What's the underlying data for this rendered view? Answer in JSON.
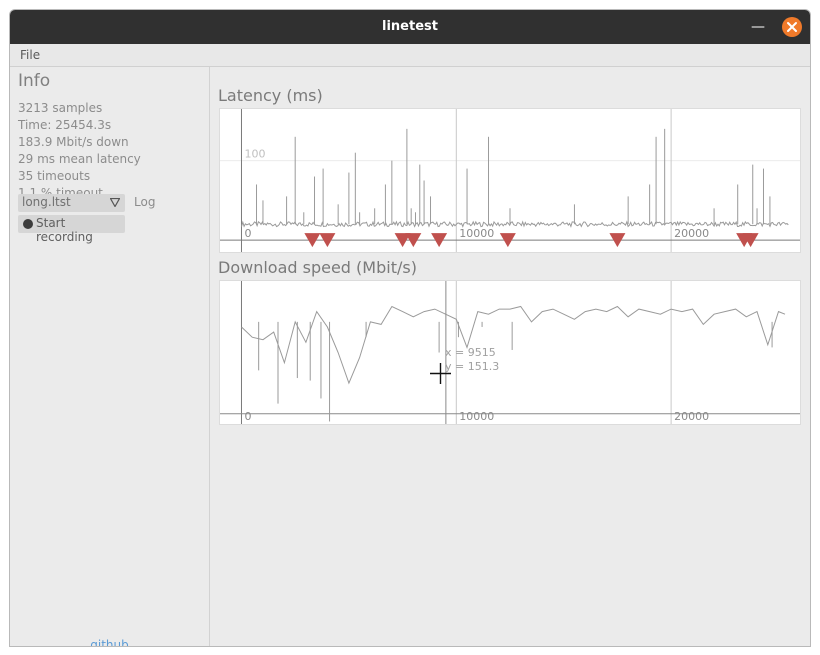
{
  "window": {
    "title": "linetest"
  },
  "menu": {
    "file_label": "File"
  },
  "sidebar": {
    "info_title": "Info",
    "stats": [
      "3213 samples",
      "Time: 25454.3s",
      "183.9 Mbit/s down",
      "29 ms mean latency",
      "35 timeouts",
      "1.1 % timeout"
    ],
    "file_select": {
      "value": "long.ltst"
    },
    "log_label": "Log",
    "record_button_label": "Start recording",
    "github_link": "github"
  },
  "latency_plot": {
    "title": "Latency (ms)",
    "x_ticks": [
      "0",
      "10000",
      "20000"
    ],
    "y_tick": "100"
  },
  "download_plot": {
    "title": "Download speed (Mbit/s)",
    "x_ticks": [
      "0",
      "10000",
      "20000"
    ],
    "cursor_readout": {
      "x": "x = 9515",
      "y": "y = 151.3"
    }
  },
  "colors": {
    "timeout_marker": "#c0504d",
    "trace": "#9a9a9a",
    "accent_close": "#f07a2a",
    "link": "#5b9bd5"
  },
  "chart_data": [
    {
      "type": "line",
      "title": "Latency (ms)",
      "x_ticks": [
        0,
        10000,
        20000
      ],
      "y_ticks": [
        100
      ],
      "xlim": [
        -1000,
        26000
      ],
      "ylim": [
        -15,
        165
      ],
      "baseline_ms": 20,
      "spikes": [
        {
          "x": 700,
          "y": 70
        },
        {
          "x": 1000,
          "y": 50
        },
        {
          "x": 2100,
          "y": 55
        },
        {
          "x": 2500,
          "y": 130
        },
        {
          "x": 2900,
          "y": 35
        },
        {
          "x": 3400,
          "y": 80
        },
        {
          "x": 3800,
          "y": 90
        },
        {
          "x": 4500,
          "y": 45
        },
        {
          "x": 5000,
          "y": 85
        },
        {
          "x": 5300,
          "y": 110
        },
        {
          "x": 5500,
          "y": 35
        },
        {
          "x": 6200,
          "y": 40
        },
        {
          "x": 6700,
          "y": 70
        },
        {
          "x": 7000,
          "y": 100
        },
        {
          "x": 7700,
          "y": 140
        },
        {
          "x": 7900,
          "y": 40
        },
        {
          "x": 8100,
          "y": 35
        },
        {
          "x": 8300,
          "y": 95
        },
        {
          "x": 8500,
          "y": 75
        },
        {
          "x": 8800,
          "y": 55
        },
        {
          "x": 10500,
          "y": 90
        },
        {
          "x": 11500,
          "y": 130
        },
        {
          "x": 12500,
          "y": 40
        },
        {
          "x": 15500,
          "y": 45
        },
        {
          "x": 18000,
          "y": 55
        },
        {
          "x": 19000,
          "y": 70
        },
        {
          "x": 19300,
          "y": 130
        },
        {
          "x": 19700,
          "y": 140
        },
        {
          "x": 22000,
          "y": 40
        },
        {
          "x": 23100,
          "y": 70
        },
        {
          "x": 23800,
          "y": 95
        },
        {
          "x": 24000,
          "y": 40
        },
        {
          "x": 24300,
          "y": 90
        },
        {
          "x": 24600,
          "y": 55
        }
      ],
      "timeouts_x": [
        3300,
        4000,
        7500,
        8000,
        9200,
        12400,
        17500,
        23400,
        23700
      ]
    },
    {
      "type": "line",
      "title": "Download speed (Mbit/s)",
      "x_ticks": [
        0,
        10000,
        20000
      ],
      "xlim": [
        -1000,
        26000
      ],
      "ylim": [
        -20,
        260
      ],
      "x": [
        0,
        500,
        1000,
        1500,
        2000,
        2500,
        3000,
        3500,
        4000,
        4500,
        5000,
        5500,
        6000,
        6500,
        7000,
        7500,
        8000,
        8500,
        9000,
        9500,
        10000,
        10500,
        11000,
        11500,
        12000,
        12500,
        13000,
        13500,
        14000,
        14500,
        15000,
        15500,
        16000,
        16500,
        17000,
        17500,
        18000,
        18500,
        19000,
        19500,
        20000,
        20500,
        21000,
        21500,
        22000,
        22500,
        23000,
        23500,
        24000,
        24500,
        25000,
        25300
      ],
      "values": [
        170,
        150,
        145,
        160,
        100,
        180,
        140,
        200,
        170,
        120,
        60,
        110,
        180,
        175,
        210,
        200,
        190,
        200,
        205,
        195,
        185,
        130,
        200,
        195,
        205,
        205,
        210,
        180,
        200,
        205,
        195,
        185,
        200,
        205,
        200,
        210,
        190,
        205,
        200,
        195,
        205,
        200,
        205,
        175,
        195,
        200,
        205,
        190,
        200,
        135,
        200,
        195
      ],
      "dips": [
        {
          "x": 800,
          "y": 85
        },
        {
          "x": 1700,
          "y": 20
        },
        {
          "x": 2600,
          "y": 70
        },
        {
          "x": 3200,
          "y": 65
        },
        {
          "x": 3700,
          "y": 30
        },
        {
          "x": 4100,
          "y": -15
        },
        {
          "x": 5800,
          "y": 150
        },
        {
          "x": 9200,
          "y": 120
        },
        {
          "x": 10100,
          "y": 150
        },
        {
          "x": 11200,
          "y": 170
        },
        {
          "x": 12600,
          "y": 125
        },
        {
          "x": 24700,
          "y": 130
        }
      ]
    }
  ]
}
